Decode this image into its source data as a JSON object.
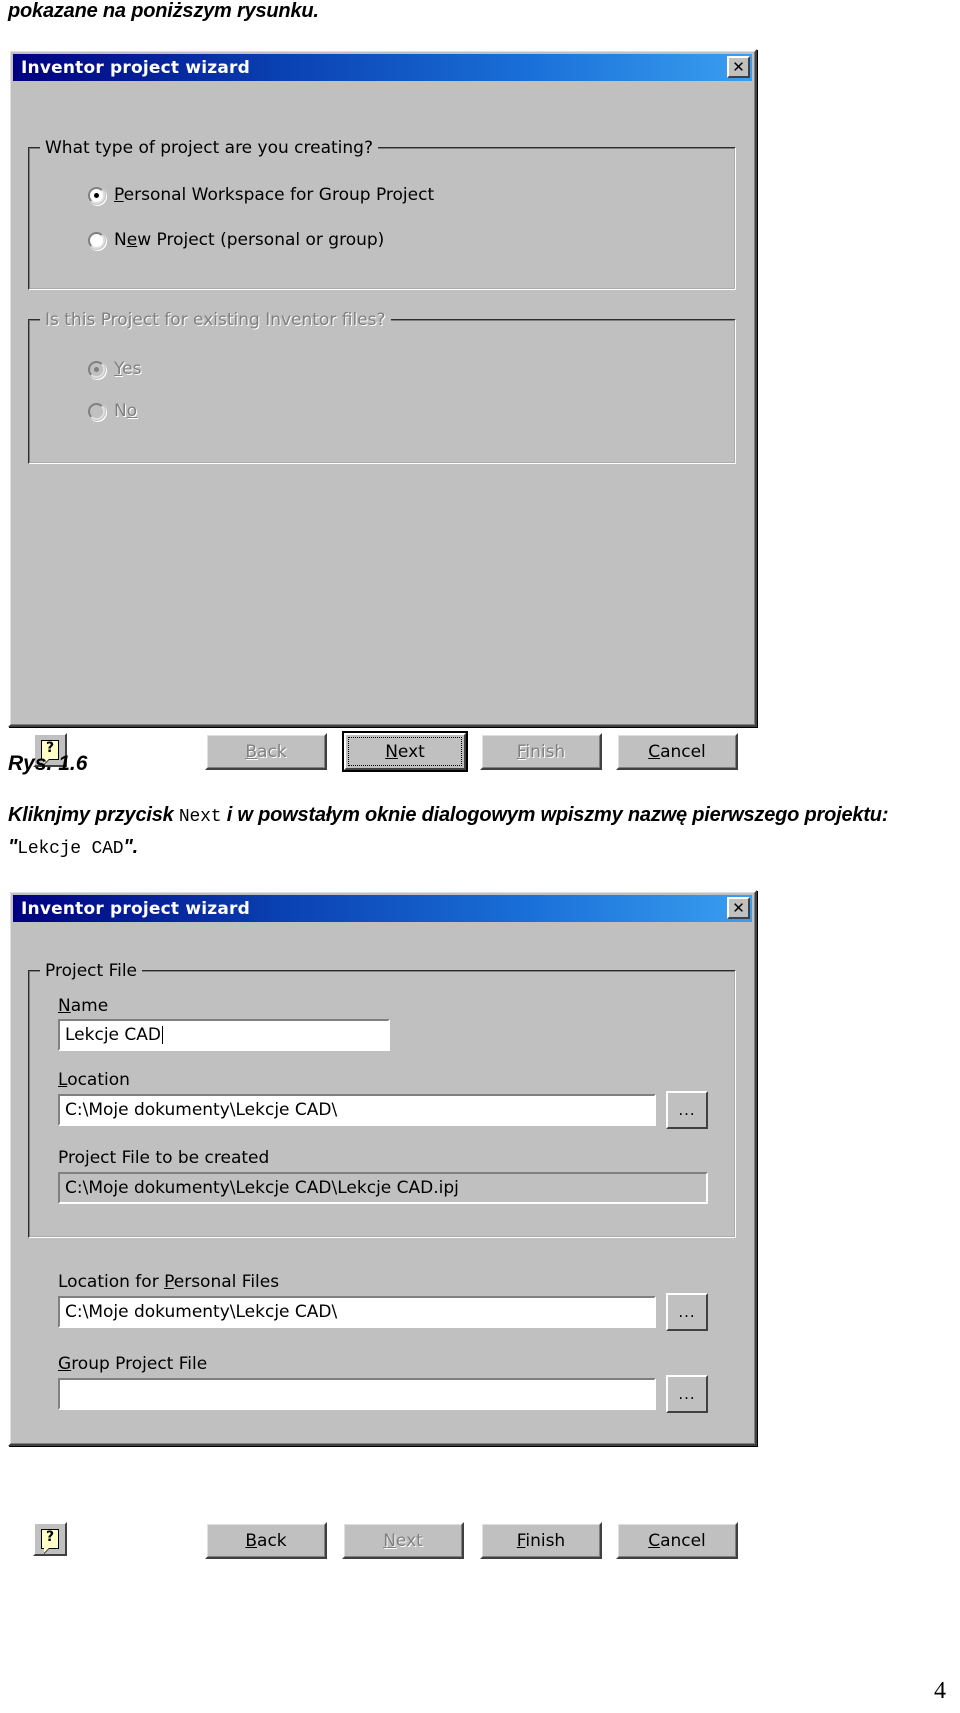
{
  "document": {
    "intro_line": "pokazane na poniższym rysunku.",
    "figure_caption": "Rys. 1.6",
    "paragraph": {
      "part1": "Kliknjmy przycisk ",
      "mono1": "Next",
      "part2": " i w powstałym oknie dialogowym wpiszmy nazwę pierwszego projektu: \"",
      "mono2": "Lekcje CAD",
      "part3": "\"."
    },
    "page_number": "4"
  },
  "dialog1": {
    "title": "Inventor project wizard",
    "close_label": "✕",
    "group1": {
      "label": "What type of project are you creating?",
      "options": [
        {
          "label_pre": "",
          "label_accel": "P",
          "label_post": "ersonal Workspace for Group Project",
          "checked": true,
          "disabled": false
        },
        {
          "label_pre": "N",
          "label_accel": "e",
          "label_post": "w Project (personal or group)",
          "checked": false,
          "disabled": false
        }
      ]
    },
    "group2": {
      "label": "Is this Project for existing Inventor files?",
      "disabled": true,
      "options": [
        {
          "label_pre": "",
          "label_accel": "Y",
          "label_post": "es",
          "checked": true,
          "disabled": true
        },
        {
          "label_pre": "N",
          "label_accel": "o",
          "label_post": "",
          "checked": false,
          "disabled": true
        }
      ]
    },
    "help_glyph": "?",
    "buttons": [
      {
        "pre": "",
        "accel": "B",
        "post": "ack",
        "disabled": true,
        "default": false
      },
      {
        "pre": "",
        "accel": "N",
        "post": "ext",
        "disabled": false,
        "default": true
      },
      {
        "pre": "",
        "accel": "F",
        "post": "inish",
        "disabled": true,
        "default": false
      },
      {
        "pre": "",
        "accel": "C",
        "post": "ancel",
        "disabled": false,
        "default": false
      }
    ]
  },
  "dialog2": {
    "title": "Inventor project wizard",
    "close_label": "✕",
    "group1_label": "Project File",
    "fields": {
      "name": {
        "label_accel": "N",
        "label_post": "ame",
        "value": "Lekcje CAD",
        "has_caret": true
      },
      "location": {
        "label_accel": "L",
        "label_post": "ocation",
        "value": "C:\\Moje dokumenty\\Lekcje CAD\\",
        "browse_label": "..."
      },
      "project_file_created": {
        "label": "Project File to be created",
        "value": "C:\\Moje dokumenty\\Lekcje CAD\\Lekcje CAD.ipj",
        "readonly": true
      },
      "personal_files": {
        "label_pre": "Location for ",
        "label_accel": "P",
        "label_post": "ersonal Files",
        "value": "C:\\Moje dokumenty\\Lekcje CAD\\",
        "browse_label": "..."
      },
      "group_project_file": {
        "label_accel": "G",
        "label_post": "roup Project File",
        "value": "",
        "browse_label": "..."
      }
    },
    "help_glyph": "?",
    "buttons": [
      {
        "pre": "",
        "accel": "B",
        "post": "ack",
        "disabled": false,
        "default": false
      },
      {
        "pre": "",
        "accel": "N",
        "post": "ext",
        "disabled": true,
        "default": false
      },
      {
        "pre": "",
        "accel": "F",
        "post": "inish",
        "disabled": false,
        "default": false
      },
      {
        "pre": "",
        "accel": "C",
        "post": "ancel",
        "disabled": false,
        "default": false
      }
    ]
  },
  "colors": {
    "face": "#c0c0c0",
    "title_start": "#000080",
    "title_end": "#3a9ff0",
    "disabled_text": "#808080",
    "help_icon": "#ffffc8"
  }
}
